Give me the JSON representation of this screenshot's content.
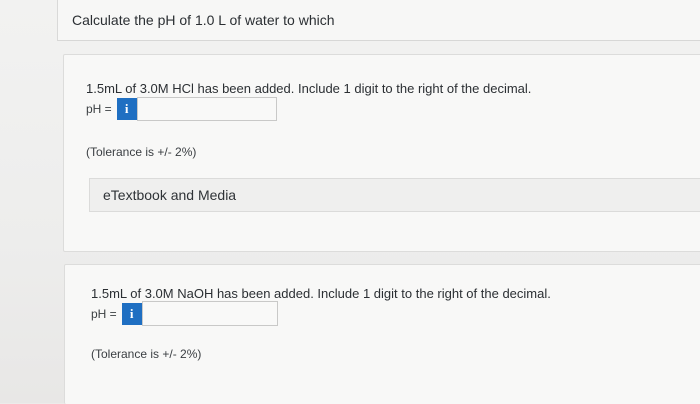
{
  "question": {
    "text": "Calculate the pH of 1.0 L of water to which"
  },
  "part_a": {
    "prompt": "1.5mL of 3.0M HCl has been added. Include 1 digit to the right of the decimal.",
    "answer_label": "pH =",
    "info_glyph": "i",
    "answer_value": "",
    "tolerance": "(Tolerance is +/- 2%)",
    "etextbook_label": "eTextbook and Media"
  },
  "part_b": {
    "prompt": "1.5mL of 3.0M NaOH has been added. Include 1 digit to the right of the decimal.",
    "answer_label": "pH =",
    "info_glyph": "i",
    "answer_value": "",
    "tolerance": "(Tolerance is +/- 2%)"
  },
  "colors": {
    "info_button": "#1f6fc2",
    "background": "#ecebea",
    "card": "#f8f8f7"
  }
}
